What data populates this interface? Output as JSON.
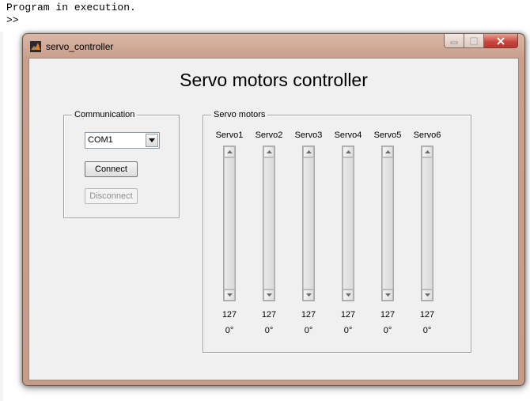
{
  "console": {
    "line1": "Program in execution.",
    "prompt": ">>"
  },
  "window": {
    "title": "servo_controller",
    "icon": "matlab-icon",
    "caption_buttons": [
      "minimize-icon",
      "maximize-icon",
      "close-icon"
    ]
  },
  "gui": {
    "heading": "Servo motors controller",
    "communication": {
      "legend": "Communication",
      "port_selected": "COM1",
      "connect_label": "Connect",
      "disconnect_label": "Disconnect",
      "disconnect_enabled": false
    },
    "servo_panel": {
      "legend": "Servo motors",
      "servos": [
        {
          "name": "Servo1",
          "value": "127",
          "angle": "0°"
        },
        {
          "name": "Servo2",
          "value": "127",
          "angle": "0°"
        },
        {
          "name": "Servo3",
          "value": "127",
          "angle": "0°"
        },
        {
          "name": "Servo4",
          "value": "127",
          "angle": "0°"
        },
        {
          "name": "Servo5",
          "value": "127",
          "angle": "0°"
        },
        {
          "name": "Servo6",
          "value": "127",
          "angle": "0°"
        }
      ]
    }
  },
  "colors": {
    "window_frame": "#c9a08c",
    "client_background": "#f0f0f0",
    "close_button": "#c7443a"
  }
}
